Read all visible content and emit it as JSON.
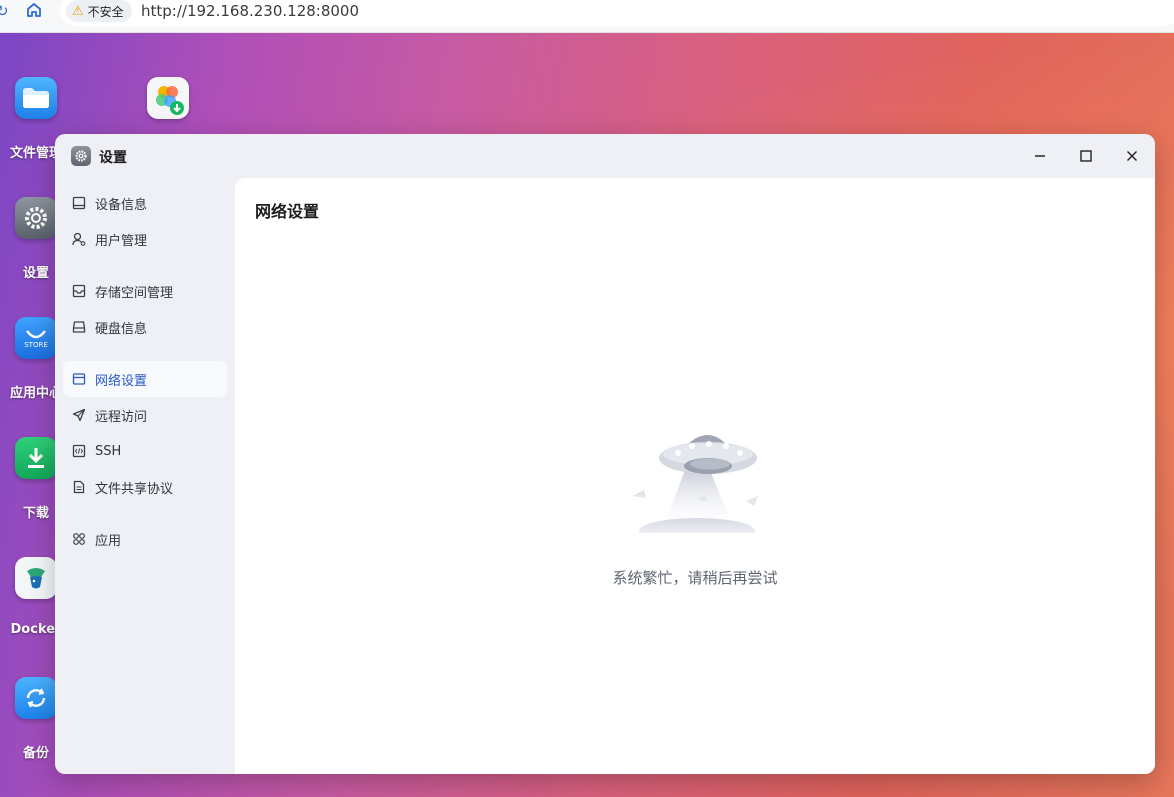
{
  "browser": {
    "security_label": "不安全",
    "url": "http://192.168.230.128:8000"
  },
  "desktop": {
    "icons": [
      {
        "label": "文件管理",
        "icon": "folder-icon"
      },
      {
        "label": "",
        "icon": "photos-app-icon"
      },
      {
        "label": "设置",
        "icon": "settings-gear-icon"
      },
      {
        "label": "应用中心",
        "icon": "store-icon"
      },
      {
        "label": "下载",
        "icon": "download-icon"
      },
      {
        "label": "Docker",
        "icon": "docker-icon"
      },
      {
        "label": "备份",
        "icon": "backup-icon"
      }
    ]
  },
  "window": {
    "title": "设置",
    "controls": [
      "minimize-icon",
      "maximize-icon",
      "close-icon"
    ]
  },
  "sidebar": {
    "items": [
      {
        "label": "设备信息",
        "icon": "device-icon"
      },
      {
        "label": "用户管理",
        "icon": "user-icon"
      },
      {
        "label": "存储空间管理",
        "icon": "storage-icon"
      },
      {
        "label": "硬盘信息",
        "icon": "disk-icon"
      },
      {
        "label": "网络设置",
        "icon": "network-icon",
        "active": true
      },
      {
        "label": "远程访问",
        "icon": "send-icon"
      },
      {
        "label": "SSH",
        "icon": "code-icon"
      },
      {
        "label": "文件共享协议",
        "icon": "document-icon"
      },
      {
        "label": "应用",
        "icon": "apps-grid-icon"
      }
    ]
  },
  "main": {
    "title": "网络设置",
    "empty_message": "系统繁忙，请稍后再尝试"
  },
  "colors": {
    "accent": "#2b59c3",
    "window_bg": "#eef0f5"
  }
}
